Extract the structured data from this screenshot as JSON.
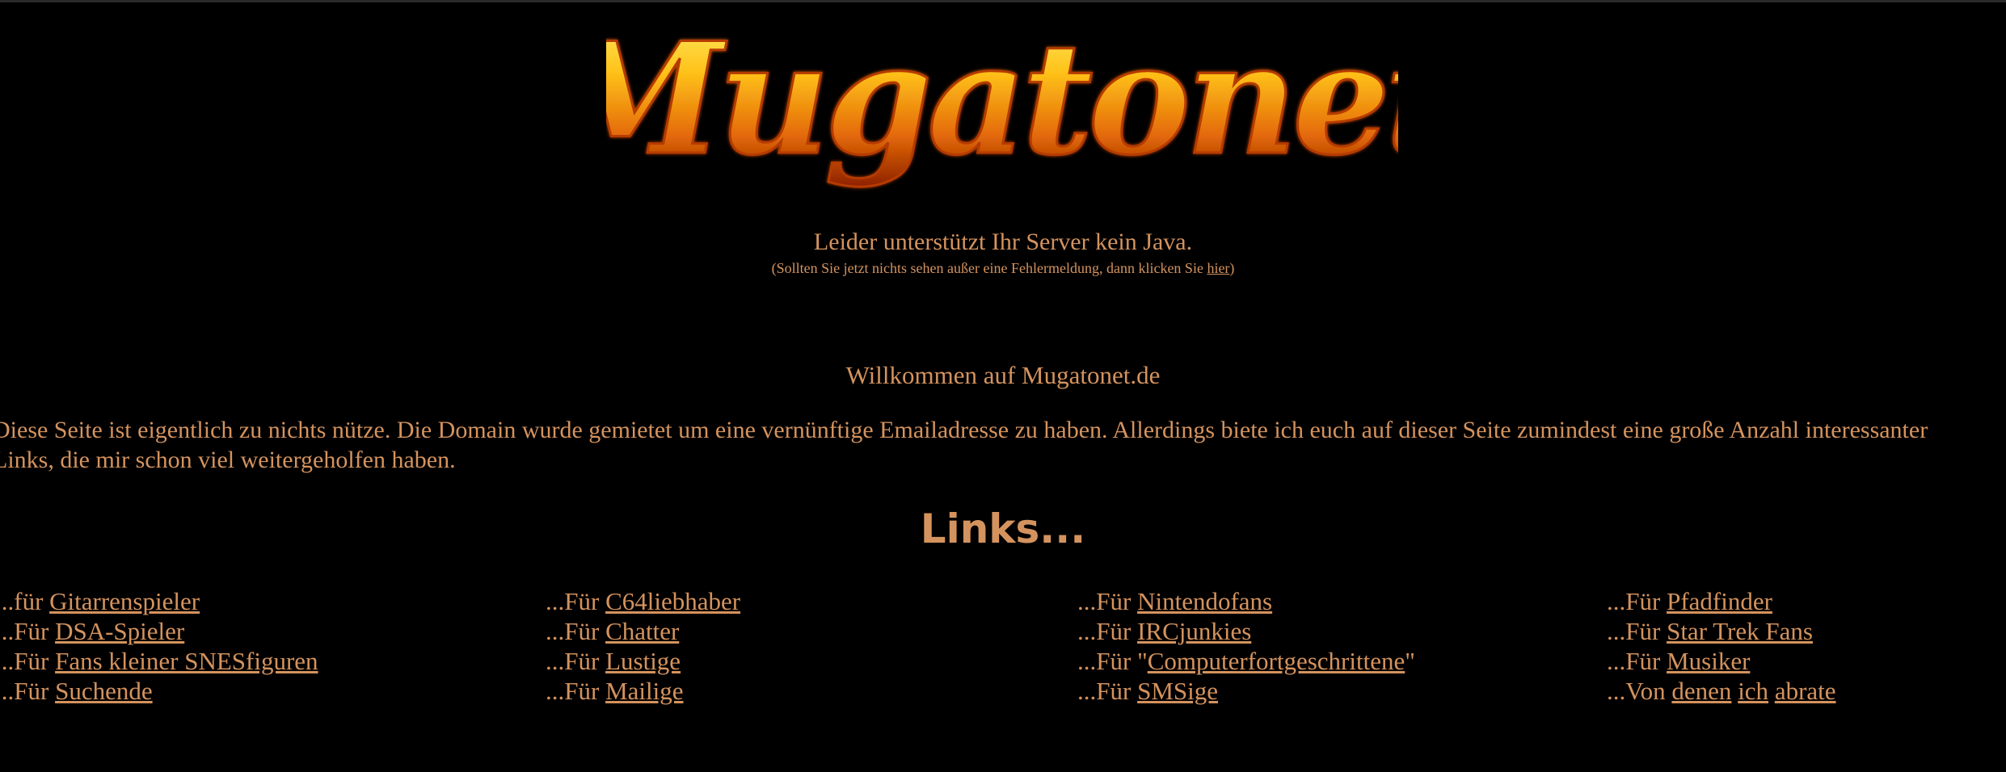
{
  "header": {
    "logo_text": "Mugatonet"
  },
  "java_notice": {
    "message": "Leider unterstützt Ihr Server kein Java.",
    "sub_prefix": "(Sollten Sie jetzt nichts sehen außer eine Fehlermeldung, dann klicken Sie ",
    "sub_link": "hier",
    "sub_suffix": ")"
  },
  "welcome": "Willkommen auf Mugatonet.de",
  "intro": "Diese Seite ist eigentlich zu nichts nütze. Die Domain wurde gemietet um eine vernünftige Emailadresse zu haben. Allerdings biete ich euch auf dieser Seite zumindest eine große Anzahl interessanter Links, die mir schon viel weitergeholfen haben.",
  "links_heading": "Links...",
  "columns": [
    [
      {
        "prefix": "...für ",
        "link": "Gitarrenspieler",
        "suffix": ""
      },
      {
        "prefix": "...Für ",
        "link": "DSA-Spieler",
        "suffix": ""
      },
      {
        "prefix": "...Für ",
        "link": "Fans kleiner SNESfiguren",
        "suffix": ""
      },
      {
        "prefix": "...Für ",
        "link": "Suchende",
        "suffix": ""
      }
    ],
    [
      {
        "prefix": "...Für ",
        "link": "C64liebhaber",
        "suffix": ""
      },
      {
        "prefix": "...Für ",
        "link": "Chatter",
        "suffix": ""
      },
      {
        "prefix": "...Für ",
        "link": "Lustige",
        "suffix": ""
      },
      {
        "prefix": "...Für ",
        "link": "Mailige",
        "suffix": ""
      }
    ],
    [
      {
        "prefix": "...Für ",
        "link": "Nintendofans",
        "suffix": ""
      },
      {
        "prefix": "...Für ",
        "link": "IRCjunkies",
        "suffix": ""
      },
      {
        "prefix": "...Für \"",
        "link": "Computerfortgeschrittene",
        "suffix": "\""
      },
      {
        "prefix": "...Für ",
        "link": "SMSige",
        "suffix": ""
      }
    ],
    [
      {
        "prefix": "...Für ",
        "link": "Pfadfinder",
        "suffix": ""
      },
      {
        "prefix": "...Für ",
        "link": "Star Trek Fans",
        "suffix": ""
      },
      {
        "prefix": "...Für ",
        "link": "Musiker",
        "suffix": ""
      }
    ]
  ],
  "last_row": {
    "prefix": "...Von ",
    "link1": "denen",
    "link2": "ich",
    "link3": "abrate"
  },
  "colors": {
    "background": "#000000",
    "text": "#d4935e"
  }
}
